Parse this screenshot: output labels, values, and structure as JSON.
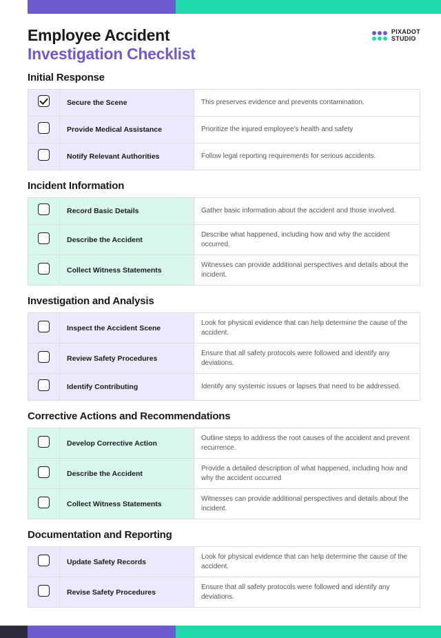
{
  "header": {
    "title_main": "Employee Accident",
    "title_sub": "Investigation Checklist",
    "logo_line1": "PIXADOT",
    "logo_line2": "STUDIO"
  },
  "sections": [
    {
      "title": "Initial Response",
      "bg": "p",
      "items": [
        {
          "checked": true,
          "title": "Secure the Scene",
          "desc": "This preserves evidence and prevents contamination."
        },
        {
          "checked": false,
          "title": "Provide Medical Assistance",
          "desc": "Prioritize the injured employee's health and safety"
        },
        {
          "checked": false,
          "title": "Notify Relevant Authorities",
          "desc": "Follow legal reporting requirements for serious accidents."
        }
      ]
    },
    {
      "title": "Incident Information",
      "bg": "t",
      "items": [
        {
          "checked": false,
          "title": "Record Basic Details",
          "desc": "Gather basic information about the accident and those involved."
        },
        {
          "checked": false,
          "title": "Describe the Accident",
          "desc": "Describe what happened, including how and why the accident occurred."
        },
        {
          "checked": false,
          "title": "Collect Witness Statements",
          "desc": "Witnesses can provide additional perspectives and details about the incident."
        }
      ]
    },
    {
      "title": "Investigation and Analysis",
      "bg": "p",
      "items": [
        {
          "checked": false,
          "title": "Inspect the Accident Scene",
          "desc": "Look for physical evidence that can help determine the cause of  the accident."
        },
        {
          "checked": false,
          "title": "Review Safety Procedures",
          "desc": "Ensure that all safety protocols were followed and identify any deviations."
        },
        {
          "checked": false,
          "title": "Identify Contributing",
          "desc": "Identify any systemic issues or lapses that need to be addressed."
        }
      ]
    },
    {
      "title": "Corrective Actions and Recommendations",
      "bg": "t",
      "items": [
        {
          "checked": false,
          "title": "Develop Corrective Action",
          "desc": "Outline steps to address the root causes of the accident and prevent recurrence."
        },
        {
          "checked": false,
          "title": "Describe the Accident",
          "desc": "Provide a detailed description of what happened, including how and why the accident occurred"
        },
        {
          "checked": false,
          "title": "Collect Witness Statements",
          "desc": "Witnesses can provide additional perspectives and details about the incident."
        }
      ]
    },
    {
      "title": "Documentation and Reporting",
      "bg": "p",
      "items": [
        {
          "checked": false,
          "title": "Update Safety Records",
          "desc": "Look for physical evidence that can help determine the cause of  the accident."
        },
        {
          "checked": false,
          "title": "Revise Safety Procedures",
          "desc": "Ensure that all safety protocols were followed and identify any deviations."
        }
      ]
    }
  ]
}
